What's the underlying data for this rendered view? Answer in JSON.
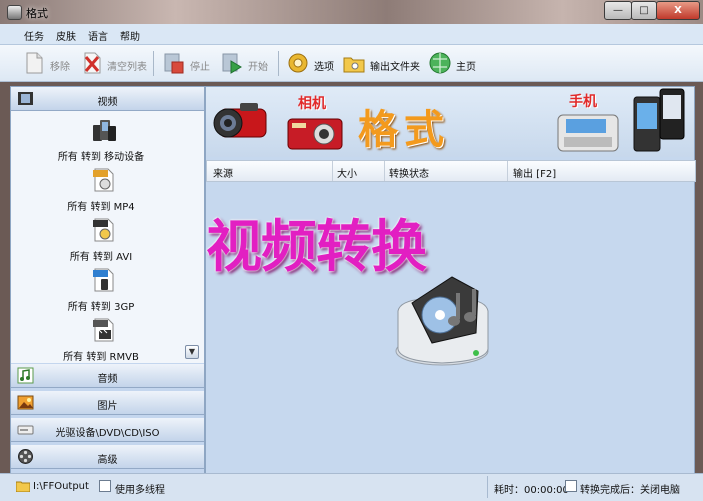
{
  "window": {
    "title": "格式",
    "buttons": {
      "minimize": "—",
      "maximize": "□",
      "close": "X"
    }
  },
  "menubar": {
    "items": [
      "任务",
      "皮肤",
      "语言",
      "帮助"
    ]
  },
  "toolbar": {
    "remove": "移除",
    "clear_list": "清空列表",
    "stop": "停止",
    "start": "开始",
    "options": "选项",
    "output_folder": "输出文件夹",
    "homepage": "主页"
  },
  "sidebar": {
    "video": "视频",
    "formats": [
      {
        "label": "所有 转到 移动设备",
        "icon": "mobile-devices-icon"
      },
      {
        "label": "所有 转到 MP4",
        "icon": "mp4-file-icon"
      },
      {
        "label": "所有 转到 AVI",
        "icon": "avi-file-icon"
      },
      {
        "label": "所有 转到 3GP",
        "icon": "3gp-file-icon"
      },
      {
        "label": "所有 转到 RMVB",
        "icon": "rmvb-file-icon"
      }
    ],
    "audio": "音频",
    "picture": "图片",
    "optical": "光驱设备\\DVD\\CD\\ISO",
    "advanced": "高级"
  },
  "banner": {
    "camera": "相机",
    "format": "格式",
    "phone": "手机"
  },
  "table": {
    "columns": [
      "来源",
      "大小",
      "转换状态",
      "输出 [F2]"
    ]
  },
  "overlay_text": "视频转换",
  "statusbar": {
    "output_path": "I:\\FFOutput",
    "multithread": "使用多线程",
    "elapsed": "耗时：00:00:00",
    "after_done": "转换完成后：关闭电脑"
  },
  "colors": {
    "accent": "#e21fc2",
    "panel": "#c6d8ee",
    "menubar": "#dae7f5"
  }
}
